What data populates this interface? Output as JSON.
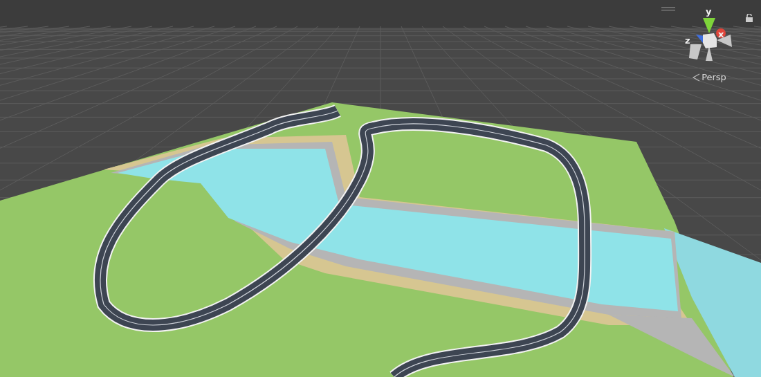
{
  "scene_view": {
    "gizmo": {
      "axes": [
        {
          "label": "y",
          "color": "#7ed43a"
        },
        {
          "label": "x",
          "color": "#e0453a"
        },
        {
          "label": "z",
          "color": "#3f6fe0"
        }
      ],
      "projection": "Persp"
    }
  }
}
